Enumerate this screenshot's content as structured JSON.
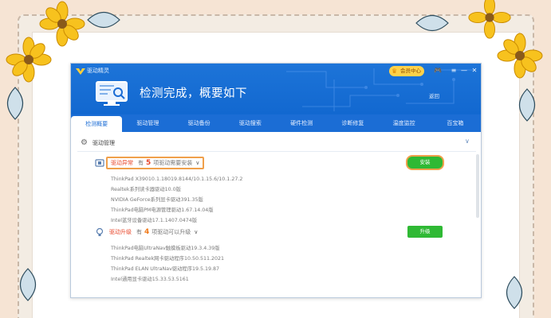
{
  "app": {
    "name": "驱动精灵",
    "vip_label": "会员中心",
    "header_title": "检测完成，概要如下",
    "back_label": "返回"
  },
  "tabs": [
    "检测概要",
    "驱动管理",
    "驱动备份",
    "驱动搜索",
    "硬件检测",
    "诊断修复",
    "温度监控",
    "百宝箱"
  ],
  "section": {
    "title": "驱动管理"
  },
  "abnormal": {
    "title": "驱动异常",
    "prefix": "有",
    "count": "5",
    "suffix": "项驱动需要安装",
    "button": "安装",
    "drivers": [
      "ThinkPad X39010.1.18019.8144/10.1.15.6/10.1.27.2",
      "Realtek系列读卡器驱动10.0版",
      "NVIDIA GeForce系列显卡驱动391.35版",
      "ThinkPad电脑PM电源管理驱动1.67.14.04版",
      "Intel蓝牙设备驱动17.1.1407.0474版"
    ]
  },
  "upgrade": {
    "title": "驱动升级",
    "prefix": "有",
    "count": "4",
    "suffix": "项驱动可以升级",
    "button": "升级",
    "drivers": [
      "ThinkPad电脑UltraNav触摸板驱动19.3.4.39版",
      "ThinkPad Realtek网卡驱动程序10.50.511.2021",
      "ThinkPad ELAN UltraNav驱动程序19.5.19.87",
      "Intel通用显卡驱动15.33.53.5161"
    ]
  },
  "colors": {
    "accent": "#1b6dd5",
    "install_green": "#2fb934",
    "warning_red": "#e8472b",
    "highlight_orange": "#f0a04b"
  }
}
